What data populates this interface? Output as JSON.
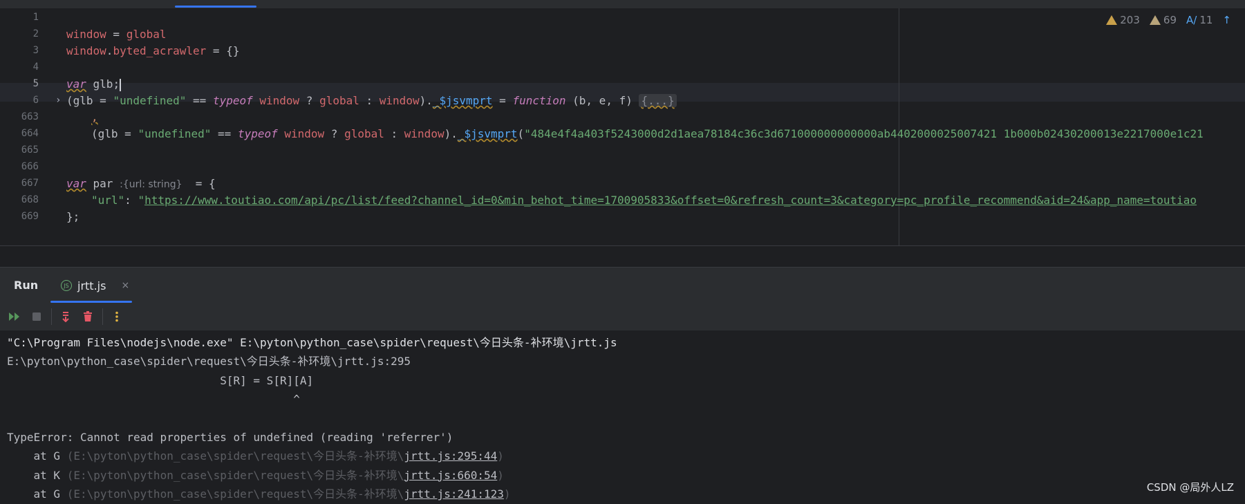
{
  "editor": {
    "warnings": {
      "errors": "203",
      "warnings": "69",
      "typos": "11"
    },
    "line_numbers": [
      "1",
      "2",
      "3",
      "4",
      "5",
      "6",
      "663",
      "664",
      "665",
      "666",
      "667",
      "668",
      "669"
    ],
    "lines": {
      "l2": {
        "a": "window",
        "b": " = ",
        "c": "global"
      },
      "l3": {
        "a": "window",
        "b": ".",
        "c": "byted_acrawler",
        "d": " = {}"
      },
      "l5": {
        "a": "var",
        "b": " glb;"
      },
      "l6": {
        "a": "(glb = ",
        "b": "\"undefined\"",
        "c": " == ",
        "d": "typeof",
        "e": " ",
        "f": "window",
        "g": " ? ",
        "h": "global",
        "i": " : ",
        "j": "window",
        "k": ").",
        "l": "_$jsvmprt",
        "m": " = ",
        "n": "function",
        "o": " (b, e, f) ",
        "p": "{...}"
      },
      "l663": {
        "a": "‚"
      },
      "l664": {
        "a": "(glb = ",
        "b": "\"undefined\"",
        "c": " == ",
        "d": "typeof",
        "e": " ",
        "f": "window",
        "g": " ? ",
        "h": "global",
        "i": " : ",
        "j": "window",
        "k": ").",
        "l": "_$jsvmprt",
        "m": "(",
        "n": "\"484e4f4a403f5243000d2d1aea78184c36c3d671000000000000ab4402000025007421 1b000b02430200013e2217000e1c21"
      },
      "l667": {
        "a": "var",
        "b": " par ",
        "hint": ":{url: string}",
        "c": "  = {"
      },
      "l668": {
        "a": "\"url\"",
        "b": ": ",
        "c": "\"",
        "d": "https://www.toutiao.com/api/pc/list/feed?channel_id=0&min_behot_time=1700905833&offset=0&refresh_count=3&category=pc_profile_recommend&aid=24&app_name=toutiao"
      },
      "l669": {
        "a": "};"
      }
    }
  },
  "run_panel": {
    "title": "Run",
    "tab_label": "jrtt.js",
    "tab_icon": "JS",
    "close": "×"
  },
  "console": {
    "lines": [
      "\"C:\\Program Files\\nodejs\\node.exe\" E:\\pyton\\python_case\\spider\\request\\今日头条-补环境\\jrtt.js",
      "E:\\pyton\\python_case\\spider\\request\\今日头条-补环境\\jrtt.js:295",
      "                                S[R] = S[R][A]",
      "                                           ^",
      "",
      "TypeError: Cannot read properties of undefined (reading 'referrer')"
    ],
    "stack": [
      {
        "at": "    at G ",
        "path": "(E:\\pyton\\python_case\\spider\\request\\今日头条-补环境\\",
        "file": "jrtt.js:295:44",
        "end": ")"
      },
      {
        "at": "    at K ",
        "path": "(E:\\pyton\\python_case\\spider\\request\\今日头条-补环境\\",
        "file": "jrtt.js:660:54",
        "end": ")"
      },
      {
        "at": "    at G ",
        "path": "(E:\\pyton\\python_case\\spider\\request\\今日头条-补环境\\",
        "file": "jrtt.js:241:123",
        "end": ")"
      }
    ]
  },
  "watermark": "CSDN @局外人LZ"
}
